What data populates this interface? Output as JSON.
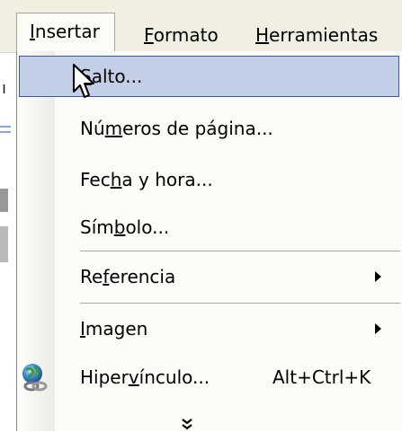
{
  "menubar": {
    "items": [
      {
        "label": "Insertar",
        "accel": "I",
        "rest": "nsertar",
        "active": true
      },
      {
        "label": "Formato",
        "accel": "F",
        "rest": "ormato"
      },
      {
        "label": "Herramientas",
        "accel": "H",
        "rest": "erramientas"
      }
    ]
  },
  "menu": {
    "items": [
      {
        "label": "Salto...",
        "pre": "",
        "accel": "S",
        "post": "alto...",
        "selected": true
      },
      {
        "label": "Números de página...",
        "pre": "Nú",
        "accel": "m",
        "post": "eros de página..."
      },
      {
        "label": "Fecha y hora...",
        "pre": "Fec",
        "accel": "h",
        "post": "a y hora..."
      },
      {
        "label": "Símbolo...",
        "pre": "Sím",
        "accel": "b",
        "post": "olo..."
      },
      {
        "label": "Referencia",
        "pre": "Re",
        "accel": "f",
        "post": "erencia",
        "submenu": true
      },
      {
        "label": "Imagen",
        "pre": "",
        "accel": "I",
        "post": "magen",
        "submenu": true
      },
      {
        "label": "Hipervínculo...",
        "pre": "Hiper",
        "accel": "v",
        "post": "ínculo...",
        "shortcut": "Alt+Ctrl+K",
        "icon": "hyperlink-globe-icon"
      }
    ],
    "expand_icon": "double-chevron-down-icon"
  },
  "background_doc": {
    "fragment": "ı"
  },
  "colors": {
    "menubar": "#f1efe2",
    "menu_bg": "#fbfbf8",
    "highlight": "#c3cfe6",
    "highlight_border": "#3a5a9a"
  }
}
